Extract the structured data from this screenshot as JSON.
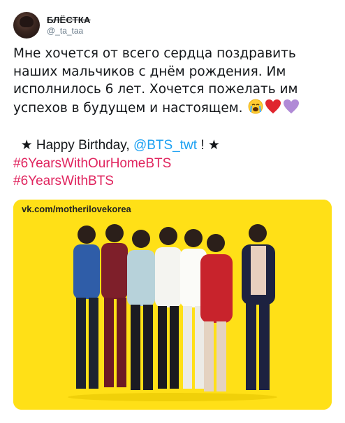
{
  "user": {
    "display_name": "БЛЁСТКА",
    "handle": "@_ta_taa"
  },
  "tweet": {
    "line1": "Мне хочется от всего сердца поздравить",
    "line2": "наших мальчиков с днём рождения. Им",
    "line3": "исполнилось 6 лет. Хочется пожелать им",
    "line4": "успехов в будущем и настоящем.",
    "emoji_icons": [
      "crying-face-icon",
      "red-heart-icon",
      "purple-heart-icon"
    ],
    "bday_prefix": "★ Happy Birthday,",
    "mention": "@BTS_twt",
    "bday_suffix": "!  ★",
    "hashtags": [
      "#6YearsWithOurHomeBTS",
      "#6YearsWithBTS"
    ]
  },
  "media": {
    "watermark": "vk.com/motherilovekorea",
    "background_color": "#ffe017"
  }
}
